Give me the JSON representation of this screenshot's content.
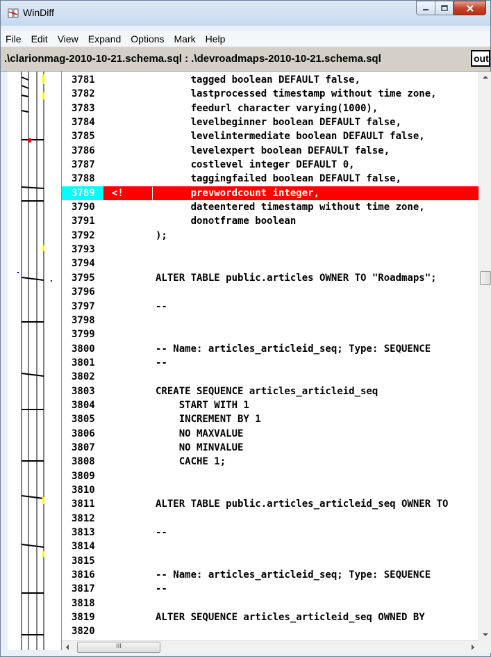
{
  "window": {
    "title": "WinDiff"
  },
  "menu": [
    "File",
    "Edit",
    "View",
    "Expand",
    "Options",
    "Mark",
    "Help"
  ],
  "path": {
    "label": ".\\clarionmag-2010-10-21.schema.sql : .\\devroadmaps-2010-10-21.schema.sql",
    "outline_button": "outline"
  },
  "colors": {
    "changed_bg": "#ff0000",
    "linenum_highlight": "#00ffff"
  },
  "lines": [
    {
      "num": "3781",
      "mark": "",
      "text": "      tagged boolean DEFAULT false,"
    },
    {
      "num": "3782",
      "mark": "",
      "text": "      lastprocessed timestamp without time zone,"
    },
    {
      "num": "3783",
      "mark": "",
      "text": "      feedurl character varying(1000),"
    },
    {
      "num": "3784",
      "mark": "",
      "text": "      levelbeginner boolean DEFAULT false,"
    },
    {
      "num": "3785",
      "mark": "",
      "text": "      levelintermediate boolean DEFAULT false,"
    },
    {
      "num": "3786",
      "mark": "",
      "text": "      levelexpert boolean DEFAULT false,"
    },
    {
      "num": "3787",
      "mark": "",
      "text": "      costlevel integer DEFAULT 0,"
    },
    {
      "num": "3788",
      "mark": "",
      "text": "      taggingfailed boolean DEFAULT false,"
    },
    {
      "num": "3789",
      "mark": "<!",
      "text": "      prevwordcount integer,",
      "changed": true
    },
    {
      "num": "3790",
      "mark": "",
      "text": "      dateentered timestamp without time zone,"
    },
    {
      "num": "3791",
      "mark": "",
      "text": "      donotframe boolean"
    },
    {
      "num": "3792",
      "mark": "",
      "text": ");"
    },
    {
      "num": "3793",
      "mark": "",
      "text": ""
    },
    {
      "num": "3794",
      "mark": "",
      "text": ""
    },
    {
      "num": "3795",
      "mark": "",
      "text": "ALTER TABLE public.articles OWNER TO \"Roadmaps\";"
    },
    {
      "num": "3796",
      "mark": "",
      "text": ""
    },
    {
      "num": "3797",
      "mark": "",
      "text": "--"
    },
    {
      "num": "3798",
      "mark": "",
      "text": ""
    },
    {
      "num": "3799",
      "mark": "",
      "text": ""
    },
    {
      "num": "3800",
      "mark": "",
      "text": "-- Name: articles_articleid_seq; Type: SEQUENCE"
    },
    {
      "num": "3801",
      "mark": "",
      "text": "--"
    },
    {
      "num": "3802",
      "mark": "",
      "text": ""
    },
    {
      "num": "3803",
      "mark": "",
      "text": "CREATE SEQUENCE articles_articleid_seq"
    },
    {
      "num": "3804",
      "mark": "",
      "text": "    START WITH 1"
    },
    {
      "num": "3805",
      "mark": "",
      "text": "    INCREMENT BY 1"
    },
    {
      "num": "3806",
      "mark": "",
      "text": "    NO MAXVALUE"
    },
    {
      "num": "3807",
      "mark": "",
      "text": "    NO MINVALUE"
    },
    {
      "num": "3808",
      "mark": "",
      "text": "    CACHE 1;"
    },
    {
      "num": "3809",
      "mark": "",
      "text": ""
    },
    {
      "num": "3810",
      "mark": "",
      "text": ""
    },
    {
      "num": "3811",
      "mark": "",
      "text": "ALTER TABLE public.articles_articleid_seq OWNER TO"
    },
    {
      "num": "3812",
      "mark": "",
      "text": ""
    },
    {
      "num": "3813",
      "mark": "",
      "text": "--"
    },
    {
      "num": "3814",
      "mark": "",
      "text": ""
    },
    {
      "num": "3815",
      "mark": "",
      "text": ""
    },
    {
      "num": "3816",
      "mark": "",
      "text": "-- Name: articles_articleid_seq; Type: SEQUENCE"
    },
    {
      "num": "3817",
      "mark": "",
      "text": "--"
    },
    {
      "num": "3818",
      "mark": "",
      "text": ""
    },
    {
      "num": "3819",
      "mark": "",
      "text": "ALTER SEQUENCE articles_articleid_seq OWNED BY"
    },
    {
      "num": "3820",
      "mark": "",
      "text": ""
    }
  ]
}
